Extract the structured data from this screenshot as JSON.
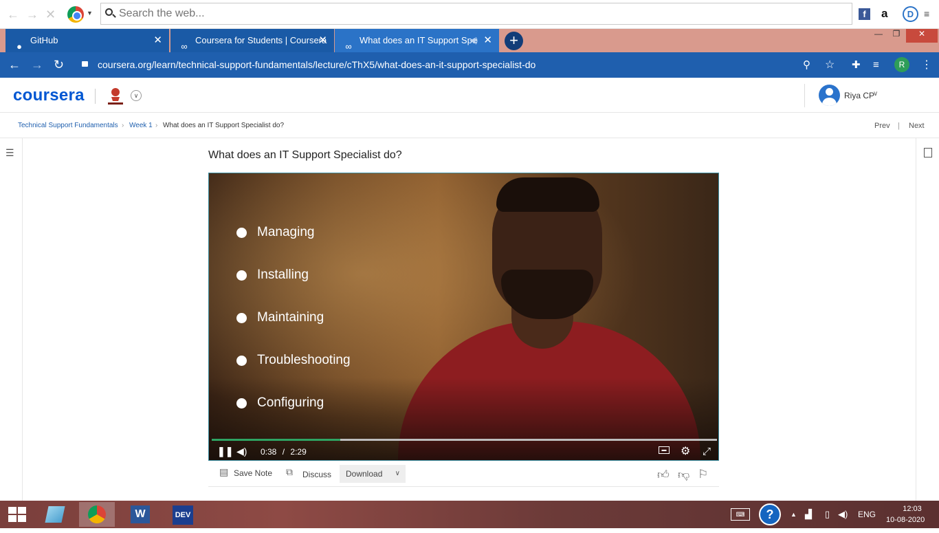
{
  "toolbar": {
    "search_placeholder": "Search the web..."
  },
  "tabs": [
    {
      "label": "GitHub"
    },
    {
      "label": "Coursera for Students | Coursera"
    },
    {
      "label": "What does an IT Support Spe"
    }
  ],
  "address": {
    "url": "coursera.org/learn/technical-support-fundamentals/lecture/cThX5/what-does-an-it-support-specialist-do",
    "profile_initial": "R"
  },
  "header": {
    "logo": "coursera",
    "user_name": "Riya CP"
  },
  "breadcrumb": {
    "course": "Technical Support Fundamentals",
    "week": "Week 1",
    "current": "What does an IT Support Specialist do?",
    "separator": "›"
  },
  "pager": {
    "prev": "Prev",
    "next": "Next",
    "divider": "|"
  },
  "lecture": {
    "title": "What does an IT Support Specialist do?",
    "bullets": [
      "Managing",
      "Installing",
      "Maintaining",
      "Troubleshooting",
      "Configuring"
    ],
    "current_time": "0:38",
    "time_separator": "/",
    "duration": "2:29",
    "progress_fraction": 0.255
  },
  "actions": {
    "save_note": "Save Note",
    "discuss": "Discuss",
    "download": "Download"
  },
  "taskbar": {
    "language": "ENG",
    "time": "12:03",
    "date": "10-08-2020",
    "dev_label": "DEV"
  },
  "colors": {
    "coursera_blue": "#0056d2",
    "progress_green": "#2ea463",
    "tab_active": "#2b73c7",
    "urlbar": "#1f5fae"
  }
}
